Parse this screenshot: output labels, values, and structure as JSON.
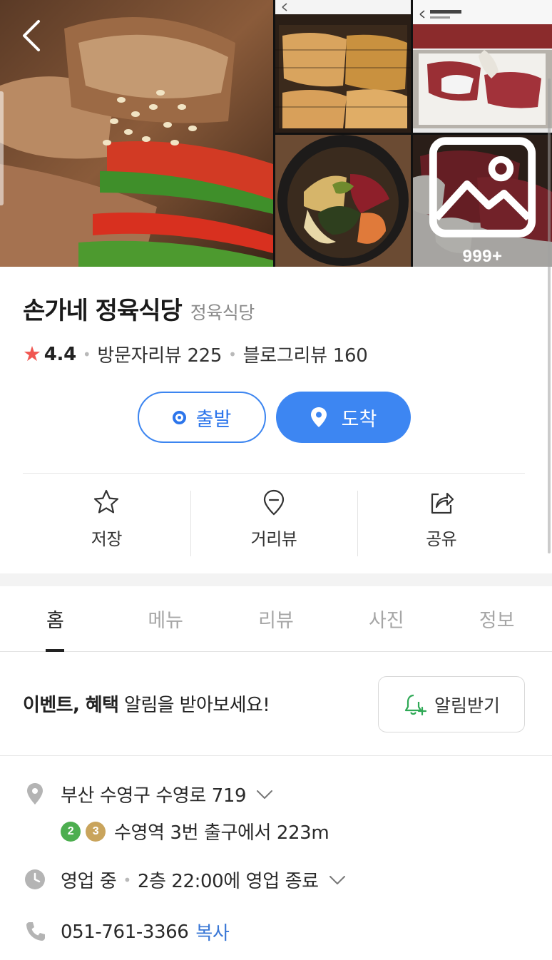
{
  "header": {
    "back_icon": "chevron-left-icon",
    "photo_count": "999+"
  },
  "place": {
    "name": "손가네 정육식당",
    "category": "정육식당"
  },
  "rating": {
    "star_icon": "star-icon",
    "score": "4.4",
    "visitor_reviews": "방문자리뷰 225",
    "blog_reviews": "블로그리뷰 160"
  },
  "directions": {
    "start_label": "출발",
    "arrive_label": "도착"
  },
  "actions": {
    "save_label": "저장",
    "street_view_label": "거리뷰",
    "share_label": "공유"
  },
  "tabs": [
    {
      "label": "홈",
      "active": true
    },
    {
      "label": "메뉴",
      "active": false
    },
    {
      "label": "리뷰",
      "active": false
    },
    {
      "label": "사진",
      "active": false
    },
    {
      "label": "정보",
      "active": false
    }
  ],
  "alarm": {
    "text_bold": "이벤트, 혜택",
    "text_rest": " 알림을 받아보세요!",
    "button_label": "알림받기"
  },
  "info": {
    "address": "부산 수영구 수영로 719",
    "subway_lines": [
      {
        "number": "2",
        "color": "#4cae4f"
      },
      {
        "number": "3",
        "color": "#c9a45c"
      }
    ],
    "subway_text": "수영역 3번 출구에서 223m",
    "hours_status": "영업 중",
    "hours_detail": "2층 22:00에 영업 종료",
    "phone": "051-761-3366",
    "copy_label": "복사"
  },
  "colors": {
    "accent_blue": "#3d86f2",
    "star_red": "#f05650",
    "link_blue": "#3977d6"
  }
}
